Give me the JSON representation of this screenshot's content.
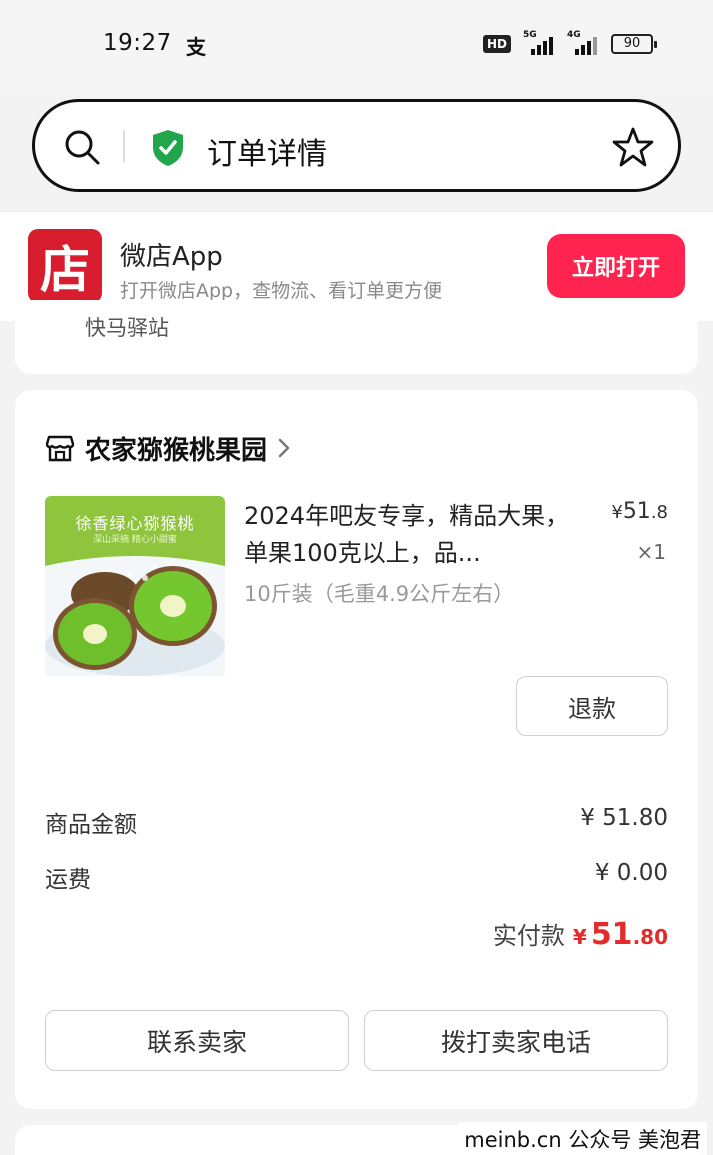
{
  "status_bar": {
    "time": "19:27",
    "app_glyph": "支",
    "hd": "HD",
    "net1": "5G",
    "net2": "4G",
    "battery": "90"
  },
  "address_bar": {
    "title": "订单详情",
    "search_icon": "search-icon",
    "secure_icon": "shield-check-icon",
    "bookmark_icon": "star-icon"
  },
  "app_banner": {
    "logo_text": "店",
    "name": "微店App",
    "description": "打开微店App，查物流、看订单更方便",
    "open_label": "立即打开",
    "accent": "#ff2450"
  },
  "partial_card": {
    "text": "快马驿站"
  },
  "order": {
    "shop_name": "农家猕猴桃果园",
    "product": {
      "image_title": "徐香绿心猕猴桃",
      "image_subtitle": "深山采摘 精心小甜蜜",
      "title": "2024年吧友专享，精品大果，单果100克以上，品...",
      "spec": "10斤装（毛重4.9公斤左右）",
      "price_prefix": "¥",
      "price_int": "51",
      "price_dec": ".8",
      "quantity": "×1"
    },
    "refund_label": "退款",
    "goods_amount_label": "商品金额",
    "goods_amount_value": "¥ 51.80",
    "shipping_label": "运费",
    "shipping_value": "¥ 0.00",
    "paid_label": "实付款",
    "paid_currency": "¥",
    "paid_int": "51",
    "paid_dec": ".80",
    "contact_seller_label": "联系卖家",
    "call_seller_label": "拨打卖家电话",
    "price_color": "#e32b2b"
  },
  "watermark": "meinb.cn 公众号 美泡君"
}
